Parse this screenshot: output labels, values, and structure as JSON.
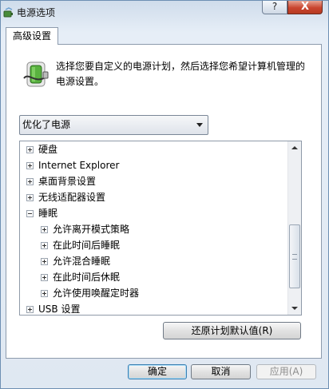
{
  "window": {
    "title": "电源选项",
    "help_label": "?",
    "close_label": "X"
  },
  "tab": {
    "label": "高级设置"
  },
  "description": "选择您要自定义的电源计划，然后选择您希望计算机管理的电源设置。",
  "plan_select": {
    "value": "优化了电源"
  },
  "tree": {
    "items": [
      {
        "label": "硬盘",
        "state": "plus",
        "level": 0
      },
      {
        "label": "Internet Explorer",
        "state": "plus",
        "level": 0
      },
      {
        "label": "桌面背景设置",
        "state": "plus",
        "level": 0
      },
      {
        "label": "无线适配器设置",
        "state": "plus",
        "level": 0
      },
      {
        "label": "睡眠",
        "state": "minus",
        "level": 0
      },
      {
        "label": "允许离开模式策略",
        "state": "plus",
        "level": 1
      },
      {
        "label": "在此时间后睡眠",
        "state": "plus",
        "level": 1
      },
      {
        "label": "允许混合睡眠",
        "state": "plus",
        "level": 1
      },
      {
        "label": "在此时间后休眠",
        "state": "plus",
        "level": 1
      },
      {
        "label": "允许使用唤醒定时器",
        "state": "plus",
        "level": 1
      },
      {
        "label": "USB 设置",
        "state": "plus",
        "level": 0
      }
    ]
  },
  "restore_button": "还原计划默认值(R)",
  "buttons": {
    "ok": "确定",
    "cancel": "取消",
    "apply": "应用(A)"
  }
}
